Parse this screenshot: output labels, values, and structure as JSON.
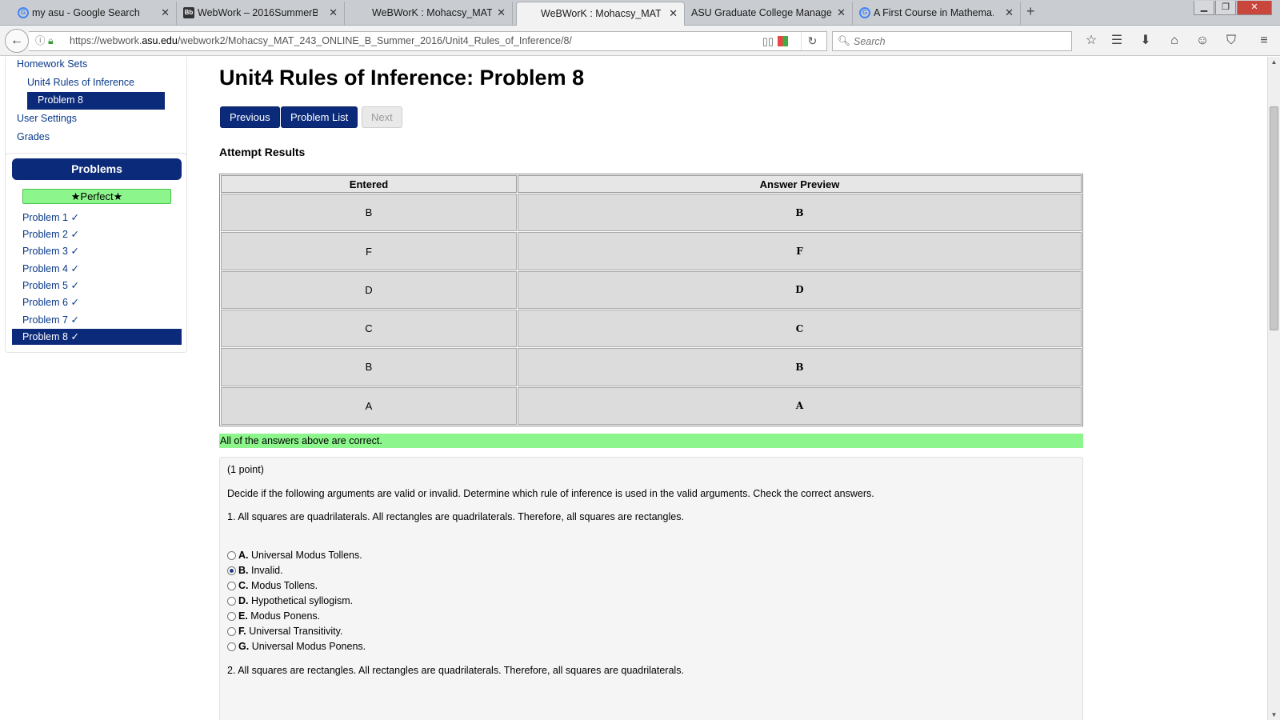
{
  "browser": {
    "tabs": [
      {
        "label": "my asu - Google Search",
        "favicon": "google-icon"
      },
      {
        "label": "WebWork – 2016SummerB...",
        "favicon": "blackboard-icon"
      },
      {
        "label": "WeBWorK : Mohacsy_MAT...",
        "favicon": ""
      },
      {
        "label": "WeBWorK : Mohacsy_MAT...",
        "favicon": ""
      },
      {
        "label": "ASU Graduate College Manage ...",
        "favicon": ""
      },
      {
        "label": "A First Course in Mathema...",
        "favicon": "google-icon"
      }
    ],
    "active_tab": 3,
    "url_prefix": "https://webwork.",
    "url_domain": "asu.edu",
    "url_suffix": "/webwork2/Mohacsy_MAT_243_ONLINE_B_Summer_2016/Unit4_Rules_of_Inference/8/",
    "search_placeholder": "Search"
  },
  "sidebar": {
    "links": {
      "homework_sets": "Homework Sets",
      "unit": "Unit4 Rules of Inference",
      "problem": "Problem 8",
      "user_settings": "User Settings",
      "grades": "Grades"
    },
    "problems_header": "Problems",
    "perfect_badge": "★Perfect★",
    "problems": [
      "Problem 1 ✓",
      "Problem 2 ✓",
      "Problem 3 ✓",
      "Problem 4 ✓",
      "Problem 5 ✓",
      "Problem 6 ✓",
      "Problem 7 ✓",
      "Problem 8 ✓"
    ],
    "active_problem": 7
  },
  "main": {
    "title": "Unit4 Rules of Inference: Problem 8",
    "buttons": {
      "previous": "Previous",
      "problem_list": "Problem List",
      "next": "Next"
    },
    "attempt_heading": "Attempt Results",
    "results": {
      "headers": [
        "Entered",
        "Answer Preview"
      ],
      "rows": [
        [
          "B",
          "B"
        ],
        [
          "F",
          "F"
        ],
        [
          "D",
          "D"
        ],
        [
          "C",
          "C"
        ],
        [
          "B",
          "B"
        ],
        [
          "A",
          "A"
        ]
      ]
    },
    "correct_message": "All of the answers above are correct.",
    "problem": {
      "points": "(1 point)",
      "instructions": "Decide if the following arguments are valid or invalid. Determine which rule of inference is used in the valid arguments. Check the correct answers.",
      "q1": "1. All squares are quadrilaterals. All rectangles are quadrilaterals. Therefore, all squares are rectangles.",
      "q1_choices": [
        {
          "letter": "A.",
          "text": "Universal Modus Tollens.",
          "checked": false
        },
        {
          "letter": "B.",
          "text": "Invalid.",
          "checked": true
        },
        {
          "letter": "C.",
          "text": "Modus Tollens.",
          "checked": false
        },
        {
          "letter": "D.",
          "text": "Hypothetical syllogism.",
          "checked": false
        },
        {
          "letter": "E.",
          "text": "Modus Ponens.",
          "checked": false
        },
        {
          "letter": "F.",
          "text": "Universal Transitivity.",
          "checked": false
        },
        {
          "letter": "G.",
          "text": "Universal Modus Ponens.",
          "checked": false
        }
      ],
      "q2": "2. All squares are rectangles. All rectangles are quadrilaterals. Therefore, all squares are quadrilaterals."
    }
  }
}
